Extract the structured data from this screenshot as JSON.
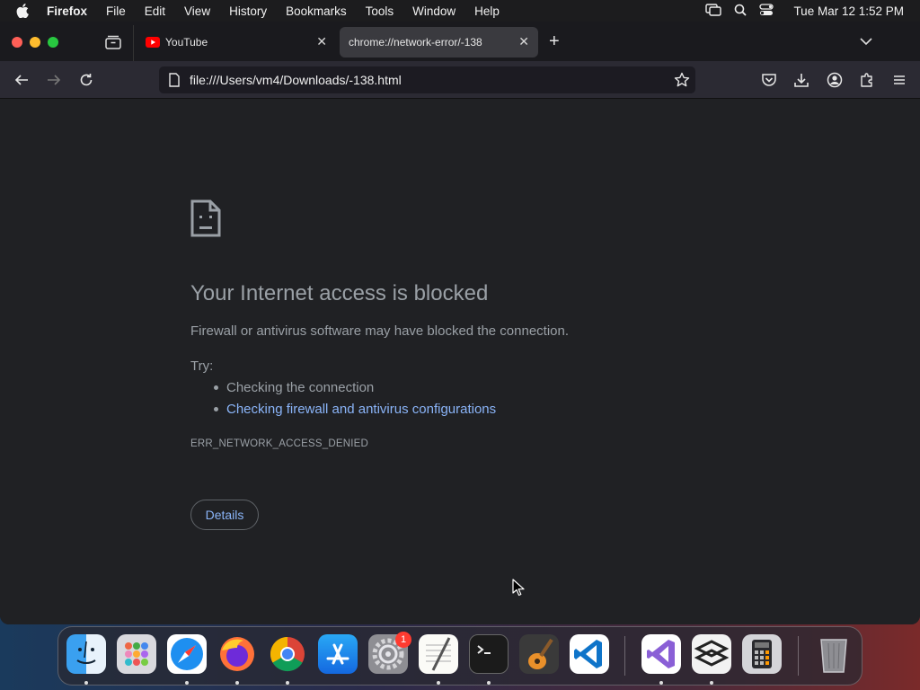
{
  "menubar": {
    "app_name": "Firefox",
    "menus": [
      "File",
      "Edit",
      "View",
      "History",
      "Bookmarks",
      "Tools",
      "Window",
      "Help"
    ],
    "clock": "Tue Mar 12  1:52 PM",
    "icons": [
      "screen-mirroring-icon",
      "spotlight-search-icon",
      "control-center-icon"
    ]
  },
  "browser": {
    "tabs": [
      {
        "title": "YouTube",
        "favicon": "youtube-icon",
        "active": false
      },
      {
        "title": "chrome://network-error/-138",
        "active": true
      }
    ],
    "url": "file:///Users/vm4/Downloads/-138.html",
    "toolbar_icons": [
      "back-icon",
      "forward-icon",
      "reload-icon",
      "bookmark-star-icon",
      "pocket-icon",
      "downloads-icon",
      "account-icon",
      "extensions-icon",
      "menu-icon"
    ]
  },
  "error_page": {
    "title": "Your Internet access is blocked",
    "description": "Firewall or antivirus software may have blocked the connection.",
    "try_label": "Try:",
    "suggestions": [
      "Checking the connection",
      "Checking firewall and antivirus configurations"
    ],
    "error_code": "ERR_NETWORK_ACCESS_DENIED",
    "details_button": "Details",
    "link_color": "#8ab4f8",
    "text_color": "#9aa0a6"
  },
  "dock": {
    "apps": [
      "Finder",
      "Launchpad",
      "Safari",
      "Firefox",
      "Google Chrome",
      "App Store",
      "System Settings",
      "TextEdit",
      "Terminal",
      "GarageBand",
      "Visual Studio Code",
      "Visual Studio",
      "Sublime Merge",
      "Calculator",
      "Trash"
    ],
    "system_settings_badge": "1"
  }
}
